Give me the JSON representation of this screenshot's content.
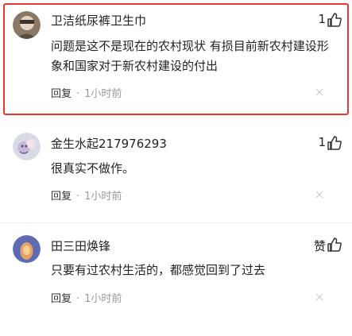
{
  "comments": [
    {
      "username": "卫洁纸尿裤卫生巾",
      "likes": "1",
      "content": "问题是这不是现在的农村现状 有损目前新农村建设形象和国家对于新农村建设的付出",
      "reply": "回复",
      "sep": "·",
      "time": "1小时前",
      "avatar_icon": "user-avatar-icon",
      "like_icon": "thumbs-up-icon",
      "close_icon": "close-icon"
    },
    {
      "username": "金生水起217976293",
      "likes": "1",
      "content": "很真实不做作。",
      "reply": "回复",
      "sep": "·",
      "time": "1小时前",
      "avatar_icon": "user-avatar-icon",
      "like_icon": "thumbs-up-icon",
      "close_icon": "close-icon"
    },
    {
      "username": "田三田焕锋",
      "likes": "赞",
      "content": "只要有过农村生活的，都感觉回到了过去",
      "reply": "回复",
      "sep": "·",
      "time": "1小时前",
      "avatar_icon": "user-avatar-icon",
      "like_icon": "thumbs-up-icon",
      "close_icon": "close-icon"
    }
  ],
  "colors": {
    "highlight_border": "#e53935",
    "text": "#222222",
    "meta": "#999999"
  }
}
